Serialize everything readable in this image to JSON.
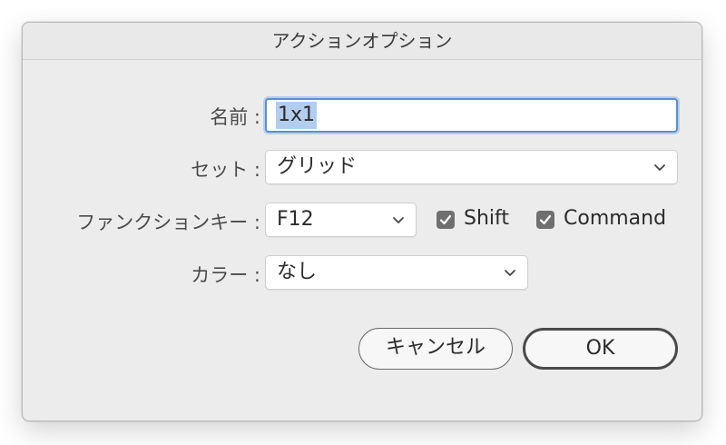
{
  "dialog": {
    "title": "アクションオプション"
  },
  "form": {
    "name_label": "名前 :",
    "name_value": "1x1",
    "set_label": "セット :",
    "set_value": "グリッド",
    "function_key_label": "ファンクションキー :",
    "function_key_value": "F12",
    "shift_label": "Shift",
    "shift_checked": true,
    "command_label": "Command",
    "command_checked": true,
    "color_label": "カラー :",
    "color_value": "なし"
  },
  "buttons": {
    "cancel": "キャンセル",
    "ok": "OK"
  },
  "icons": {
    "chevron": "chevron-down-icon",
    "check": "checkmark-icon"
  },
  "colors": {
    "focus_ring": "#5a8fd8",
    "selection": "#b3cdef",
    "checkbox": "#6f6f6f"
  }
}
